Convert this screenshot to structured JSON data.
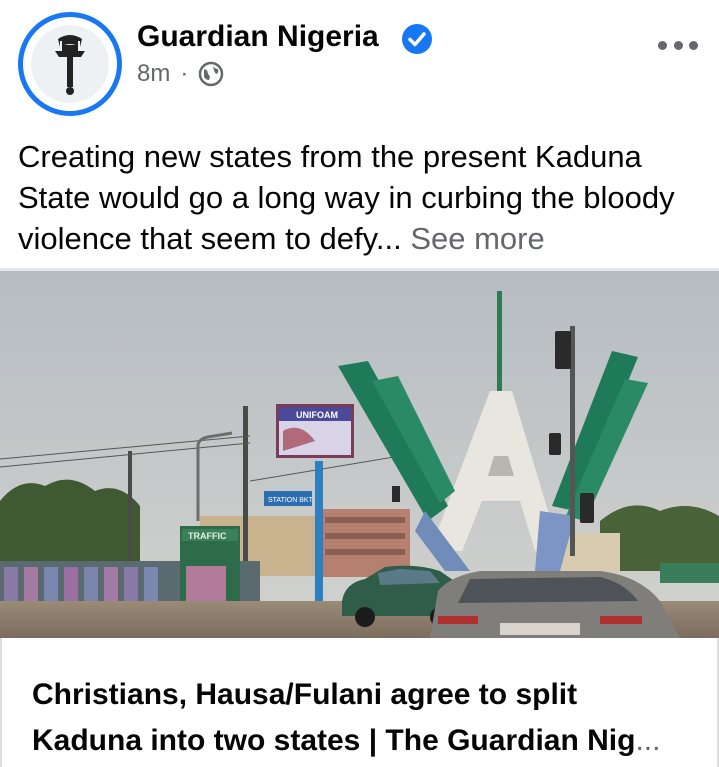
{
  "post": {
    "page_name": "Guardian Nigeria",
    "verified": true,
    "time_ago": "8m",
    "separator": "·",
    "audience_icon": "globe-icon",
    "text": "Creating new states from the present Kaduna State would go a long way in curbing the bloody violence that seem to defy...",
    "see_more": "See more"
  },
  "photo": {
    "billboard_text": "UNIFOAM",
    "sign_text": "TRAFFIC",
    "street_sign_text": "STATION BKT"
  },
  "link": {
    "title": "Christians, Hausa/Fulani agree to split Kaduna into two states | The Guardian Nig",
    "ellipsis": "..."
  },
  "colors": {
    "accent": "#1877f2",
    "secondary_text": "#65676b",
    "monument_green": "#1f7a5a",
    "monument_white": "#e9e6df"
  }
}
